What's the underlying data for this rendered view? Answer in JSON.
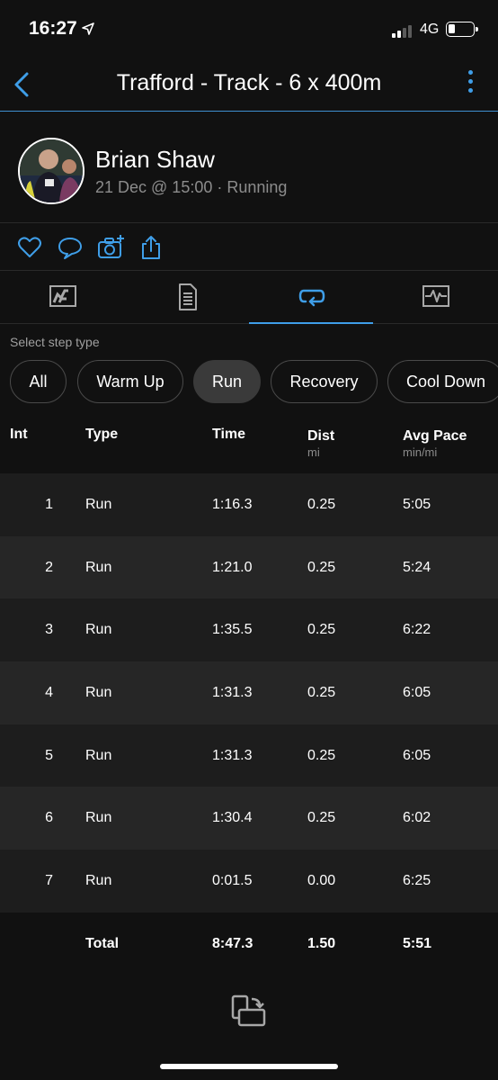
{
  "status_bar": {
    "time": "16:27",
    "network": "4G"
  },
  "nav": {
    "title": "Trafford - Track - 6 x 400m"
  },
  "profile": {
    "name": "Brian Shaw",
    "meta": "21 Dec @ 15:00 · Running"
  },
  "filter": {
    "label": "Select step type",
    "chips": [
      "All",
      "Warm Up",
      "Run",
      "Recovery",
      "Cool Down"
    ],
    "selected": "Run"
  },
  "table": {
    "headers": {
      "int": "Int",
      "type": "Type",
      "time": "Time",
      "dist": "Dist",
      "dist_unit": "mi",
      "pace": "Avg Pace",
      "pace_unit": "min/mi"
    },
    "rows": [
      {
        "int": "1",
        "type": "Run",
        "time": "1:16.3",
        "dist": "0.25",
        "pace": "5:05"
      },
      {
        "int": "2",
        "type": "Run",
        "time": "1:21.0",
        "dist": "0.25",
        "pace": "5:24"
      },
      {
        "int": "3",
        "type": "Run",
        "time": "1:35.5",
        "dist": "0.25",
        "pace": "6:22"
      },
      {
        "int": "4",
        "type": "Run",
        "time": "1:31.3",
        "dist": "0.25",
        "pace": "6:05"
      },
      {
        "int": "5",
        "type": "Run",
        "time": "1:31.3",
        "dist": "0.25",
        "pace": "6:05"
      },
      {
        "int": "6",
        "type": "Run",
        "time": "1:30.4",
        "dist": "0.25",
        "pace": "6:02"
      },
      {
        "int": "7",
        "type": "Run",
        "time": "0:01.5",
        "dist": "0.00",
        "pace": "6:25"
      }
    ],
    "total": {
      "label": "Total",
      "time": "8:47.3",
      "dist": "1.50",
      "pace": "5:51"
    }
  },
  "colors": {
    "accent": "#3f9ee8",
    "background": "#111111",
    "row_odd": "#1d1d1d",
    "row_even": "#262626"
  }
}
